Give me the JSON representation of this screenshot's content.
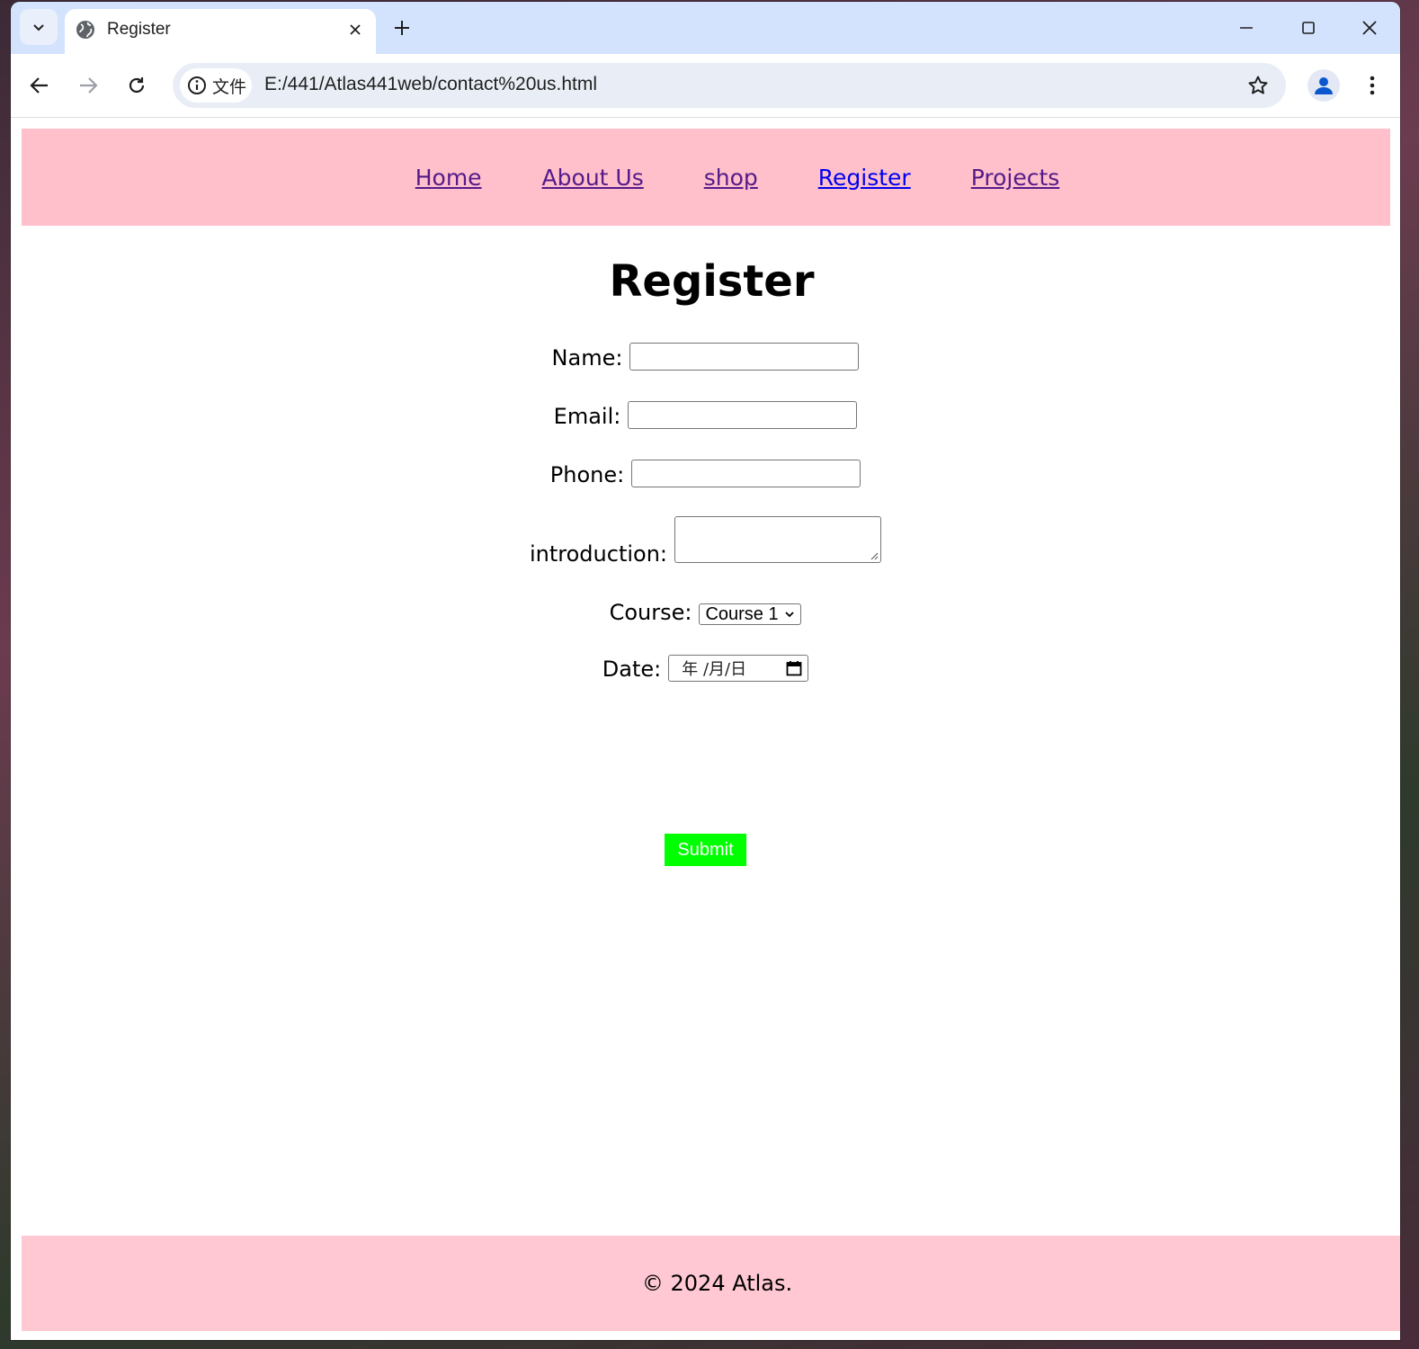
{
  "browser": {
    "tab": {
      "title": "Register"
    },
    "site_chip_label": "文件",
    "url": "E:/441/Atlas441web/contact%20us.html"
  },
  "page": {
    "nav": [
      {
        "label": "Home",
        "current": false
      },
      {
        "label": "About Us",
        "current": false
      },
      {
        "label": "shop",
        "current": false
      },
      {
        "label": "Register",
        "current": true
      },
      {
        "label": "Projects",
        "current": false
      }
    ],
    "heading": "Register",
    "form": {
      "name_label": "Name:",
      "name_value": "",
      "email_label": "Email:",
      "email_value": "",
      "phone_label": "Phone:",
      "phone_value": "",
      "intro_label": "introduction:",
      "intro_value": "",
      "course_label": "Course:",
      "course_selected": "Course 1",
      "date_label": "Date:",
      "date_placeholder": "年 /月/日",
      "submit_label": "Submit"
    },
    "footer": "© 2024 Atlas."
  },
  "colors": {
    "nav_background": "#ffc0cb",
    "footer_background": "#ffc8d2",
    "submit_background": "#00ff00",
    "link_visited": "#551a8b",
    "link_current": "#0000ee",
    "tabstrip": "#d3e3fd"
  },
  "icons": {
    "tab_search": "chevron-down-icon",
    "favicon": "globe-icon",
    "tab_close": "close-icon",
    "new_tab": "plus-icon",
    "minimize": "minimize-icon",
    "maximize": "maximize-icon",
    "close_window": "close-icon",
    "back": "arrow-left-icon",
    "forward": "arrow-right-icon",
    "reload": "reload-icon",
    "site_info": "info-icon",
    "bookmark": "star-icon",
    "profile": "person-icon",
    "menu": "kebab-menu-icon",
    "calendar": "calendar-icon",
    "select_arrow": "chevron-down-icon"
  }
}
